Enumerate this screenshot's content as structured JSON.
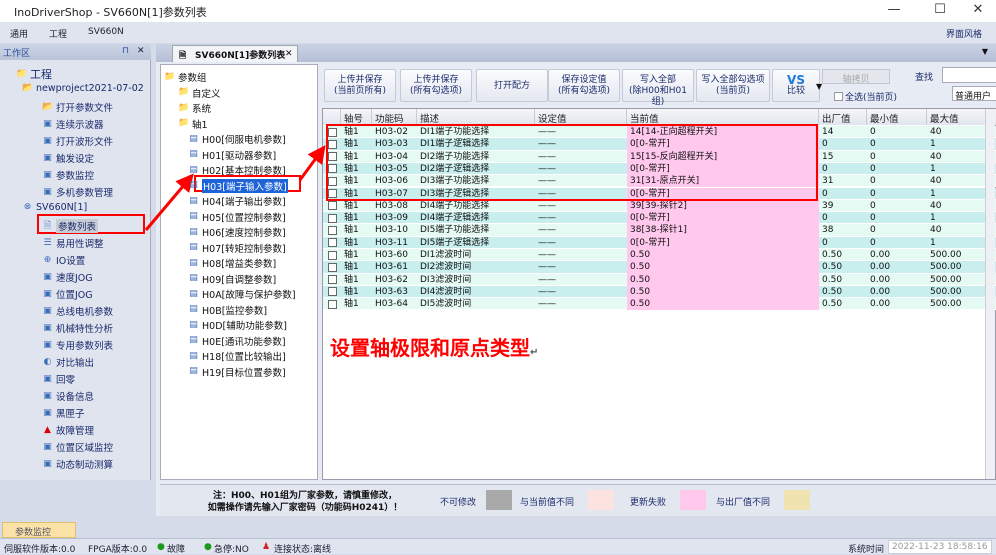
{
  "window": {
    "title": "InoDriverShop - SV660N[1]参数列表",
    "minimize": "—",
    "maximize": "☐",
    "close": "✕"
  },
  "menu": {
    "items": [
      "通用",
      "工程",
      "SV660N"
    ],
    "style_label": "界面风格"
  },
  "workspace": {
    "title": "工作区",
    "pin": "⊓",
    "close": "✕",
    "tree": [
      {
        "label": "工程",
        "icon": "folder-icon",
        "level": 0
      },
      {
        "label": "newproject2021-07-02",
        "icon": "open-folder-icon",
        "level": 1
      },
      {
        "label": "打开参数文件",
        "icon": "open-folder-icon",
        "level": 2
      },
      {
        "label": "连续示波器",
        "icon": "oscilloscope-icon",
        "level": 2
      },
      {
        "label": "打开波形文件",
        "icon": "waveform-file-icon",
        "level": 2
      },
      {
        "label": "触发设定",
        "icon": "trigger-icon",
        "level": 2
      },
      {
        "label": "参数监控",
        "icon": "monitor-icon",
        "level": 2
      },
      {
        "label": "多机参数管理",
        "icon": "multi-machine-icon",
        "level": 2
      },
      {
        "label": "SV660N[1]",
        "icon": "drive-offline-icon",
        "level": 1
      },
      {
        "label": "参数列表",
        "icon": "document-icon",
        "level": 2,
        "selected": true
      },
      {
        "label": "易用性调整",
        "icon": "sliders-icon",
        "level": 2
      },
      {
        "label": "IO设置",
        "icon": "crosshair-icon",
        "level": 2
      },
      {
        "label": "速度JOG",
        "icon": "speed-jog-icon",
        "level": 2
      },
      {
        "label": "位置JOG",
        "icon": "position-jog-icon",
        "level": 2
      },
      {
        "label": "总线电机参数",
        "icon": "motor-params-icon",
        "level": 2
      },
      {
        "label": "机械特性分析",
        "icon": "analysis-icon",
        "level": 2
      },
      {
        "label": "专用参数列表",
        "icon": "special-list-icon",
        "level": 2
      },
      {
        "label": "对比输出",
        "icon": "contrast-icon",
        "level": 2
      },
      {
        "label": "回零",
        "icon": "homing-icon",
        "level": 2
      },
      {
        "label": "设备信息",
        "icon": "device-info-icon",
        "level": 2
      },
      {
        "label": "黑匣子",
        "icon": "black-box-icon",
        "level": 2
      },
      {
        "label": "故障管理",
        "icon": "warning-icon",
        "level": 2
      },
      {
        "label": "位置区域监控",
        "icon": "position-monitor-icon",
        "level": 2
      },
      {
        "label": "动态制动测算",
        "icon": "brake-icon",
        "level": 2
      }
    ]
  },
  "doc_tab": {
    "label": "SV660N[1]参数列表",
    "close": "✕"
  },
  "groups": {
    "items": [
      {
        "label": "参数组",
        "level": 0
      },
      {
        "label": "自定义",
        "level": 1
      },
      {
        "label": "系统",
        "level": 1
      },
      {
        "label": "轴1",
        "level": 2
      },
      {
        "label": "H00[伺服电机参数]",
        "level": 3
      },
      {
        "label": "H01[驱动器参数]",
        "level": 3
      },
      {
        "label": "H02[基本控制参数]",
        "level": 3
      },
      {
        "label": "H03[端子输入参数]",
        "level": 3,
        "selected": true
      },
      {
        "label": "H04[端子输出参数]",
        "level": 3
      },
      {
        "label": "H05[位置控制参数]",
        "level": 3
      },
      {
        "label": "H06[速度控制参数]",
        "level": 3
      },
      {
        "label": "H07[转矩控制参数]",
        "level": 3
      },
      {
        "label": "H08[增益类参数]",
        "level": 3
      },
      {
        "label": "H09[自调整参数]",
        "level": 3
      },
      {
        "label": "H0A[故障与保护参数]",
        "level": 3
      },
      {
        "label": "H0B[监控参数]",
        "level": 3
      },
      {
        "label": "H0D[辅助功能参数]",
        "level": 3
      },
      {
        "label": "H0E[通讯功能参数]",
        "level": 3
      },
      {
        "label": "H18[位置比较输出]",
        "level": 3
      },
      {
        "label": "H19[目标位置参数]",
        "level": 3
      }
    ]
  },
  "toolbar": {
    "buttons": [
      "上传并保存\n(当前页所有)",
      "上传并保存\n(所有勾选项)",
      "打开配方",
      "保存设定值\n(所有勾选项)",
      "写入全部\n(除H00和H01组)",
      "写入全部勾选项\n(当前页)"
    ],
    "compare": "比较",
    "compare_icon": "VS",
    "axis_copy": "轴拷贝",
    "select_all": "全选(当前页)",
    "search_label": "查找",
    "search_value": "",
    "user_level": "普通用户"
  },
  "table": {
    "columns": [
      "轴号",
      "功能码ID",
      "描述",
      "设定值",
      "当前值",
      "出厂值",
      "最小值",
      "最大值"
    ],
    "rows": [
      [
        "轴1",
        "H03-02",
        "DI1端子功能选择",
        "——",
        "14[14-正向超程开关]",
        "14",
        "0",
        "40"
      ],
      [
        "轴1",
        "H03-03",
        "DI1端子逻辑选择",
        "——",
        "0[0-常开]",
        "0",
        "0",
        "1"
      ],
      [
        "轴1",
        "H03-04",
        "DI2端子功能选择",
        "——",
        "15[15-反向超程开关]",
        "15",
        "0",
        "40"
      ],
      [
        "轴1",
        "H03-05",
        "DI2端子逻辑选择",
        "——",
        "0[0-常开]",
        "0",
        "0",
        "1"
      ],
      [
        "轴1",
        "H03-06",
        "DI3端子功能选择",
        "——",
        "31[31-原点开关]",
        "31",
        "0",
        "40"
      ],
      [
        "轴1",
        "H03-07",
        "DI3端子逻辑选择",
        "——",
        "0[0-常开]",
        "0",
        "0",
        "1"
      ],
      [
        "轴1",
        "H03-08",
        "DI4端子功能选择",
        "——",
        "39[39-探针2]",
        "39",
        "0",
        "40"
      ],
      [
        "轴1",
        "H03-09",
        "DI4端子逻辑选择",
        "——",
        "0[0-常开]",
        "0",
        "0",
        "1"
      ],
      [
        "轴1",
        "H03-10",
        "DI5端子功能选择",
        "——",
        "38[38-探针1]",
        "38",
        "0",
        "40"
      ],
      [
        "轴1",
        "H03-11",
        "DI5端子逻辑选择",
        "——",
        "0[0-常开]",
        "0",
        "0",
        "1"
      ],
      [
        "轴1",
        "H03-60",
        "DI1滤波时间",
        "——",
        "0.50",
        "0.50",
        "0.00",
        "500.00"
      ],
      [
        "轴1",
        "H03-61",
        "DI2滤波时间",
        "——",
        "0.50",
        "0.50",
        "0.00",
        "500.00"
      ],
      [
        "轴1",
        "H03-62",
        "DI3滤波时间",
        "——",
        "0.50",
        "0.50",
        "0.00",
        "500.00"
      ],
      [
        "轴1",
        "H03-63",
        "DI4滤波时间",
        "——",
        "0.50",
        "0.50",
        "0.00",
        "500.00"
      ],
      [
        "轴1",
        "H03-64",
        "DI5滤波时间",
        "——",
        "0.50",
        "0.50",
        "0.00",
        "500.00"
      ]
    ]
  },
  "annotation": {
    "text": "设置轴极限和原点类型",
    "mark": "↵",
    "color": "#ff0000"
  },
  "legend": {
    "note_line1": "注：H00、H01组为厂家参数，请慎重修改，",
    "note_line2": "如需操作请先输入厂家密码（功能码H0241）！",
    "items": [
      {
        "label": "不可修改",
        "color": "#a9a9a9"
      },
      {
        "label": "与当前值不同",
        "color": "#fde3e0"
      },
      {
        "label": "更新失败",
        "color": "#ffc8ec"
      },
      {
        "label": "与出厂值不同",
        "color": "#efe3b0"
      }
    ]
  },
  "colors": {
    "row_a": "#e6faf4",
    "row_b": "#c9eeee",
    "current_value": "#ffc8ec"
  },
  "bottom_tab": {
    "label": "参数监控"
  },
  "status": {
    "servo_fw": "伺服软件版本:0.0",
    "fpga": "FPGA版本:0.0",
    "fault": "故障",
    "estop": "急停:NO",
    "connection": "连接状态:离线",
    "time_label": "系统时间",
    "time_value": "2022-11-23 18:58:16"
  }
}
